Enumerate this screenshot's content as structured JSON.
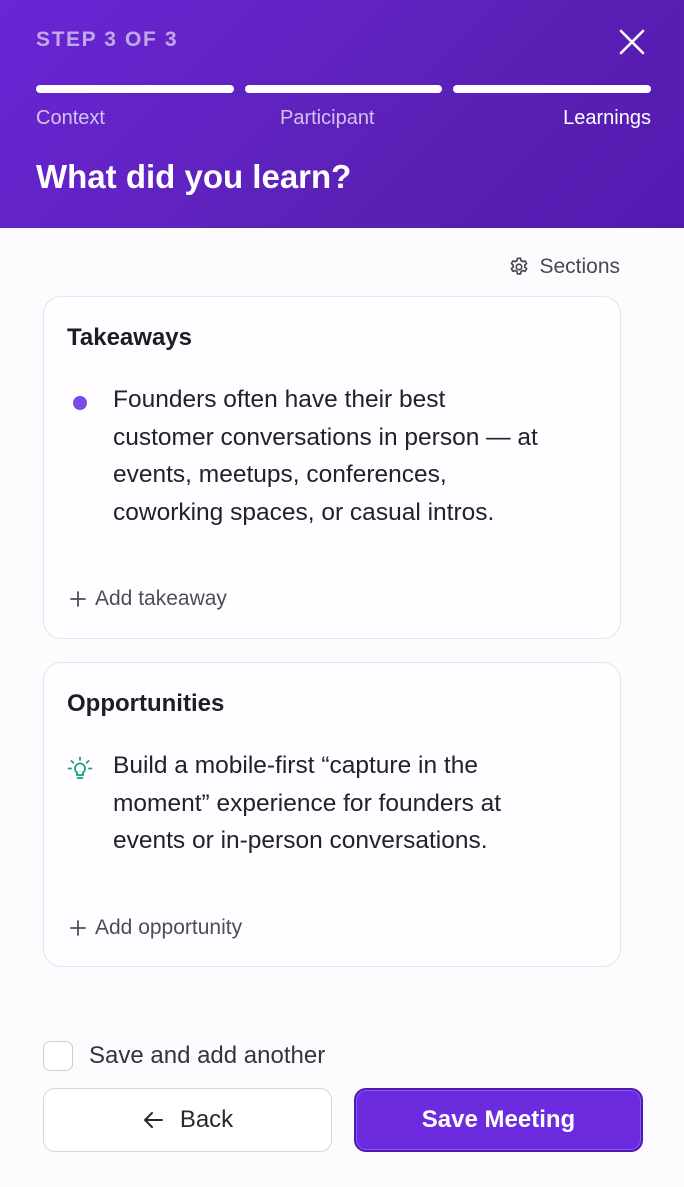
{
  "header": {
    "step_label": "STEP 3 OF 3",
    "steps": [
      "Context",
      "Participant",
      "Learnings"
    ],
    "title": "What did you learn?",
    "close_icon": "close-icon"
  },
  "sections_link": {
    "label": "Sections",
    "icon": "gear-icon"
  },
  "takeaways": {
    "title": "Takeaways",
    "items": [
      "Founders often have their best customer conversations in person — at events, meetups, conferences, coworking spaces, or casual intros."
    ],
    "add_label": "Add takeaway",
    "bullet_color": "#7c4ae8"
  },
  "opportunities": {
    "title": "Opportunities",
    "items": [
      "Build a mobile-first “capture in the moment” experience for founders at events or in-person conversations."
    ],
    "add_label": "Add opportunity",
    "icon": "lightbulb-icon",
    "icon_color": "#10a37f"
  },
  "footer": {
    "save_another_label": "Save and add another",
    "save_another_checked": false,
    "back_label": "Back",
    "save_label": "Save Meeting"
  },
  "colors": {
    "accent": "#6d2be0",
    "header_bg": "#5b21b6"
  }
}
